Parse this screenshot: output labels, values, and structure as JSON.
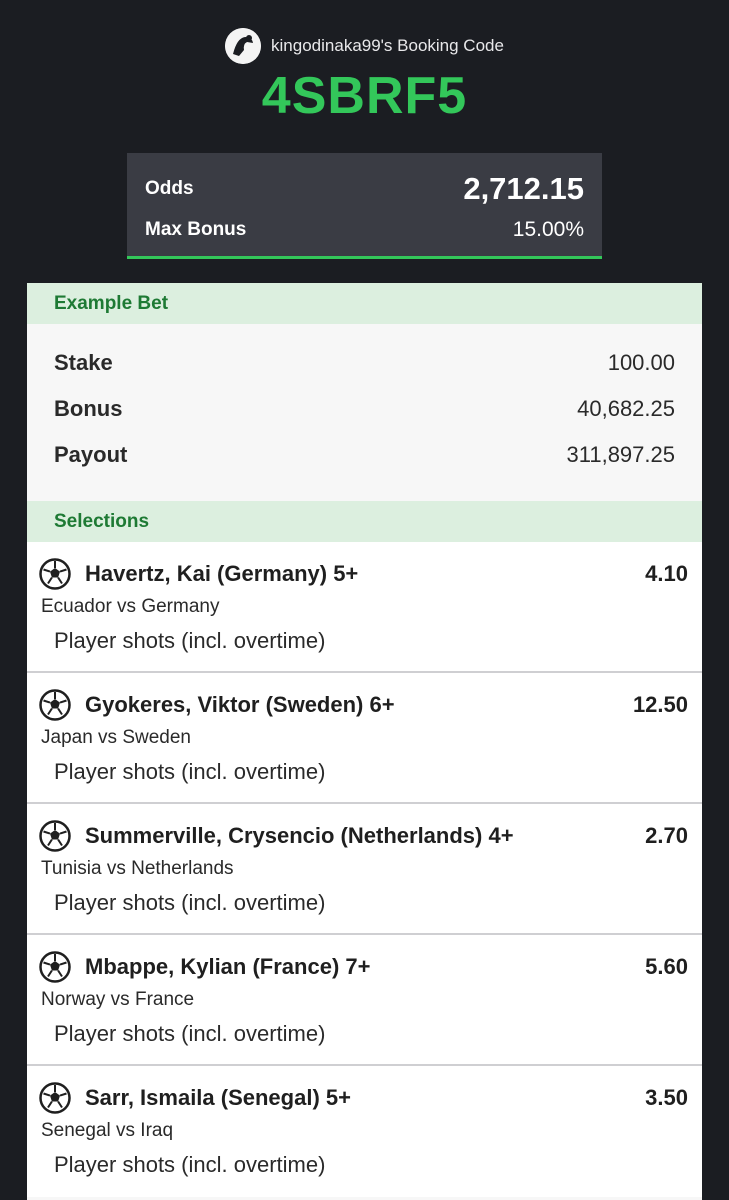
{
  "header": {
    "owner_label": "kingodinaka99's Booking Code",
    "booking_code": "4SBRF5",
    "avatar_icon": "user-avatar-icon",
    "accent_color": "#33c75a"
  },
  "odds_box": {
    "odds_label": "Odds",
    "odds_value": "2,712.15",
    "bonus_label": "Max Bonus",
    "bonus_value": "15.00%"
  },
  "example_bet": {
    "title": "Example Bet",
    "rows": [
      {
        "label": "Stake",
        "value": "100.00"
      },
      {
        "label": "Bonus",
        "value": "40,682.25"
      },
      {
        "label": "Payout",
        "value": "311,897.25"
      }
    ]
  },
  "selections": {
    "title": "Selections",
    "items": [
      {
        "icon": "soccer-ball-icon",
        "player": "Havertz, Kai (Germany) 5+",
        "odds": "4.10",
        "match": "Ecuador vs Germany",
        "market": "Player shots (incl. overtime)"
      },
      {
        "icon": "soccer-ball-icon",
        "player": "Gyokeres, Viktor (Sweden) 6+",
        "odds": "12.50",
        "match": "Japan vs Sweden",
        "market": "Player shots (incl. overtime)"
      },
      {
        "icon": "soccer-ball-icon",
        "player": "Summerville, Crysencio (Netherlands) 4+",
        "odds": "2.70",
        "match": "Tunisia vs Netherlands",
        "market": "Player shots (incl. overtime)"
      },
      {
        "icon": "soccer-ball-icon",
        "player": "Mbappe, Kylian (France) 7+",
        "odds": "5.60",
        "match": "Norway vs France",
        "market": "Player shots (incl. overtime)"
      },
      {
        "icon": "soccer-ball-icon",
        "player": "Sarr, Ismaila (Senegal) 5+",
        "odds": "3.50",
        "match": "Senegal vs Iraq",
        "market": "Player shots (incl. overtime)"
      }
    ]
  }
}
